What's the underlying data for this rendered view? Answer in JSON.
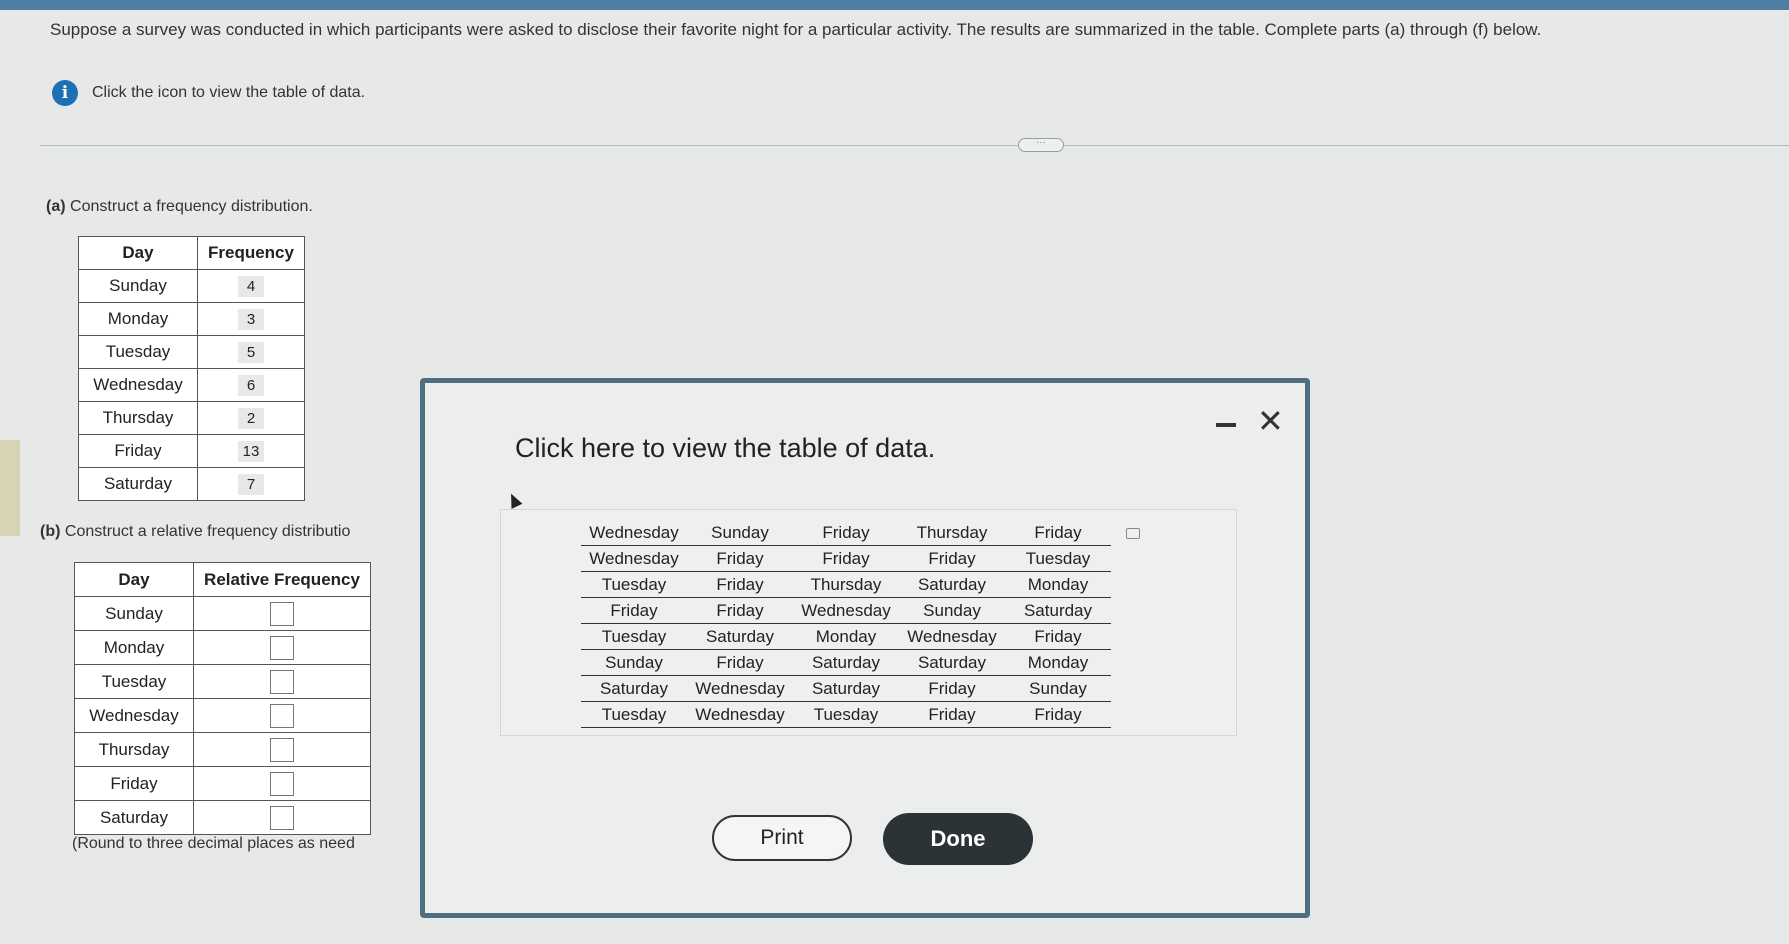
{
  "question": "Suppose a survey was conducted in which participants were asked to disclose their favorite night for a particular activity. The results are summarized in the table. Complete parts (a) through (f) below.",
  "info_text": "Click the icon to view the table of data.",
  "info_icon": "info-icon",
  "part_a": {
    "label": "(a)",
    "text": "Construct a frequency distribution.",
    "headers": [
      "Day",
      "Frequency"
    ],
    "rows": [
      {
        "day": "Sunday",
        "value": "4"
      },
      {
        "day": "Monday",
        "value": "3"
      },
      {
        "day": "Tuesday",
        "value": "5"
      },
      {
        "day": "Wednesday",
        "value": "6"
      },
      {
        "day": "Thursday",
        "value": "2"
      },
      {
        "day": "Friday",
        "value": "13"
      },
      {
        "day": "Saturday",
        "value": "7"
      }
    ]
  },
  "part_b": {
    "label": "(b)",
    "text": "Construct a relative frequency distributio",
    "headers": [
      "Day",
      "Relative Frequency"
    ],
    "days": [
      "Sunday",
      "Monday",
      "Tuesday",
      "Wednesday",
      "Thursday",
      "Friday",
      "Saturday"
    ],
    "round_note": "(Round to three decimal places as need"
  },
  "modal": {
    "title": "Click here to view the table of data.",
    "grid": [
      [
        "Wednesday",
        "Sunday",
        "Friday",
        "Thursday",
        "Friday"
      ],
      [
        "Wednesday",
        "Friday",
        "Friday",
        "Friday",
        "Tuesday"
      ],
      [
        "Tuesday",
        "Friday",
        "Thursday",
        "Saturday",
        "Monday"
      ],
      [
        "Friday",
        "Friday",
        "Wednesday",
        "Sunday",
        "Saturday"
      ],
      [
        "Tuesday",
        "Saturday",
        "Monday",
        "Wednesday",
        "Friday"
      ],
      [
        "Sunday",
        "Friday",
        "Saturday",
        "Saturday",
        "Monday"
      ],
      [
        "Saturday",
        "Wednesday",
        "Saturday",
        "Friday",
        "Sunday"
      ],
      [
        "Tuesday",
        "Wednesday",
        "Tuesday",
        "Friday",
        "Friday"
      ]
    ],
    "print_label": "Print",
    "done_label": "Done"
  },
  "colors": {
    "accent": "#1f6fb5",
    "modal_border": "#4f6f7f",
    "done_bg": "#2c3336"
  }
}
